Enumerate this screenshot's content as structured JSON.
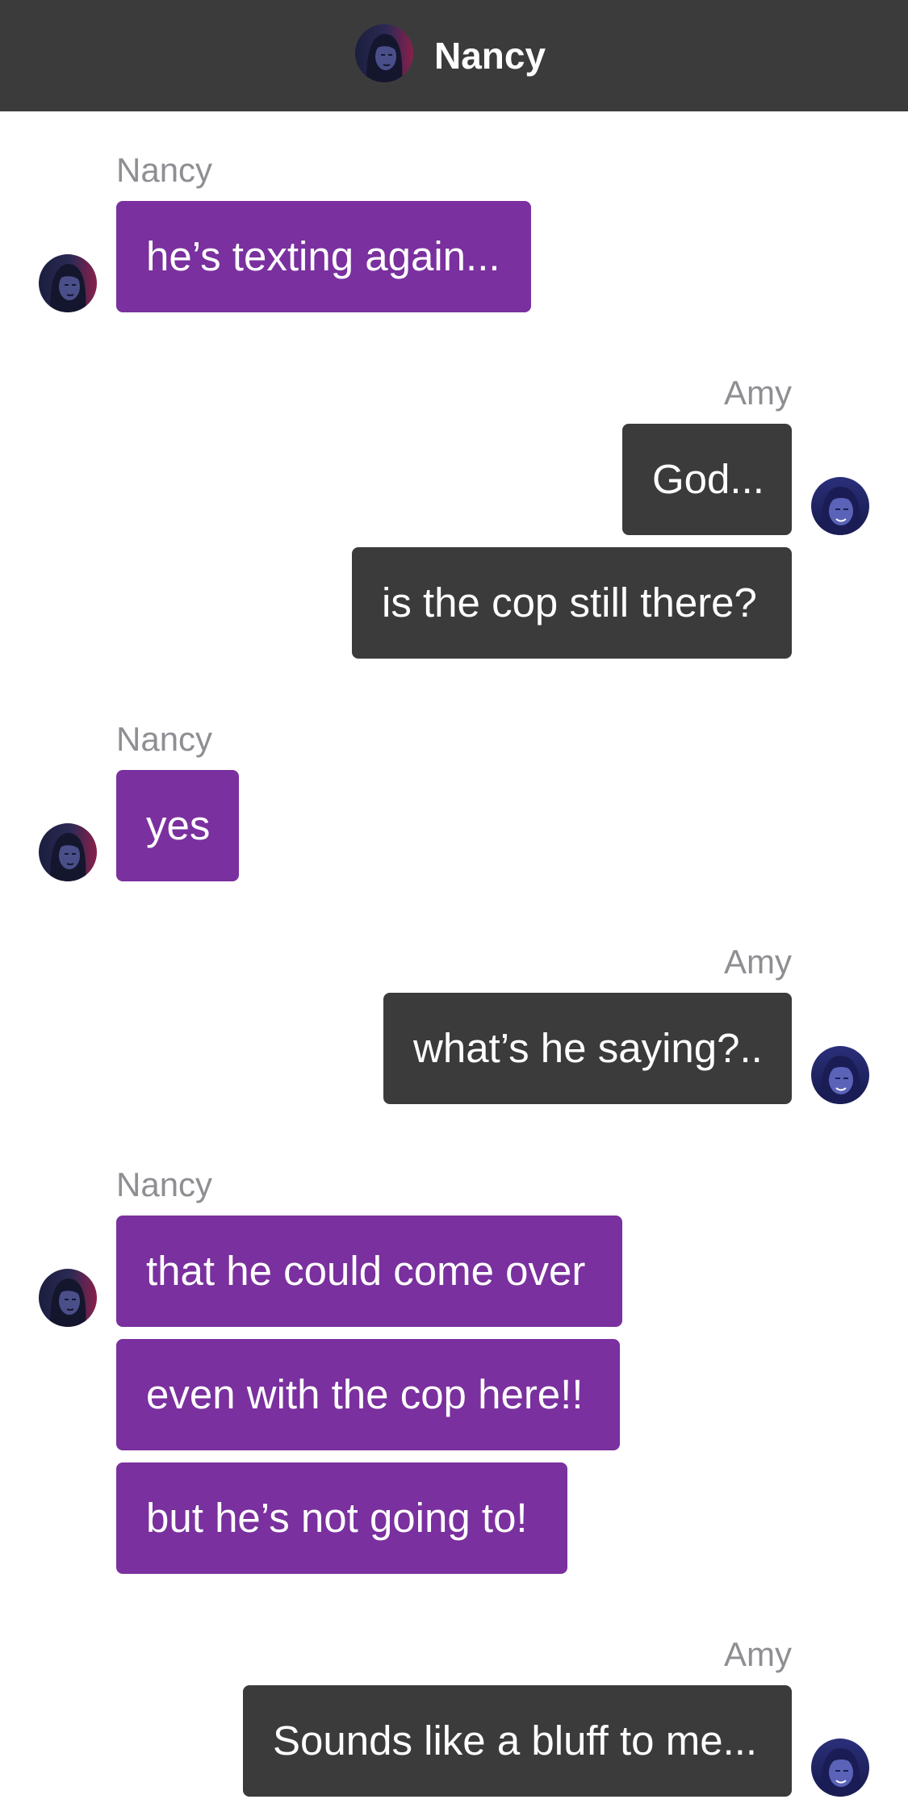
{
  "header": {
    "contact_name": "Nancy"
  },
  "colors": {
    "header_bg": "#3b3b3b",
    "nancy_bubble": "#7a309e",
    "amy_bubble": "#3b3b3b",
    "sender_label": "#8e8e93"
  },
  "icons": {
    "nancy_avatar": "nancy-avatar-icon",
    "amy_avatar": "amy-avatar-icon"
  },
  "groups": [
    {
      "sender": "Nancy",
      "messages": [
        "he’s texting again..."
      ]
    },
    {
      "sender": "Amy",
      "messages": [
        "God...",
        "is the cop still there?"
      ]
    },
    {
      "sender": "Nancy",
      "messages": [
        "yes"
      ]
    },
    {
      "sender": "Amy",
      "messages": [
        "what’s he saying?.."
      ]
    },
    {
      "sender": "Nancy",
      "messages": [
        "that he could come over",
        "even with the cop here!!",
        "but he’s not going to!"
      ]
    },
    {
      "sender": "Amy",
      "messages": [
        "Sounds like a bluff to me..."
      ]
    }
  ]
}
